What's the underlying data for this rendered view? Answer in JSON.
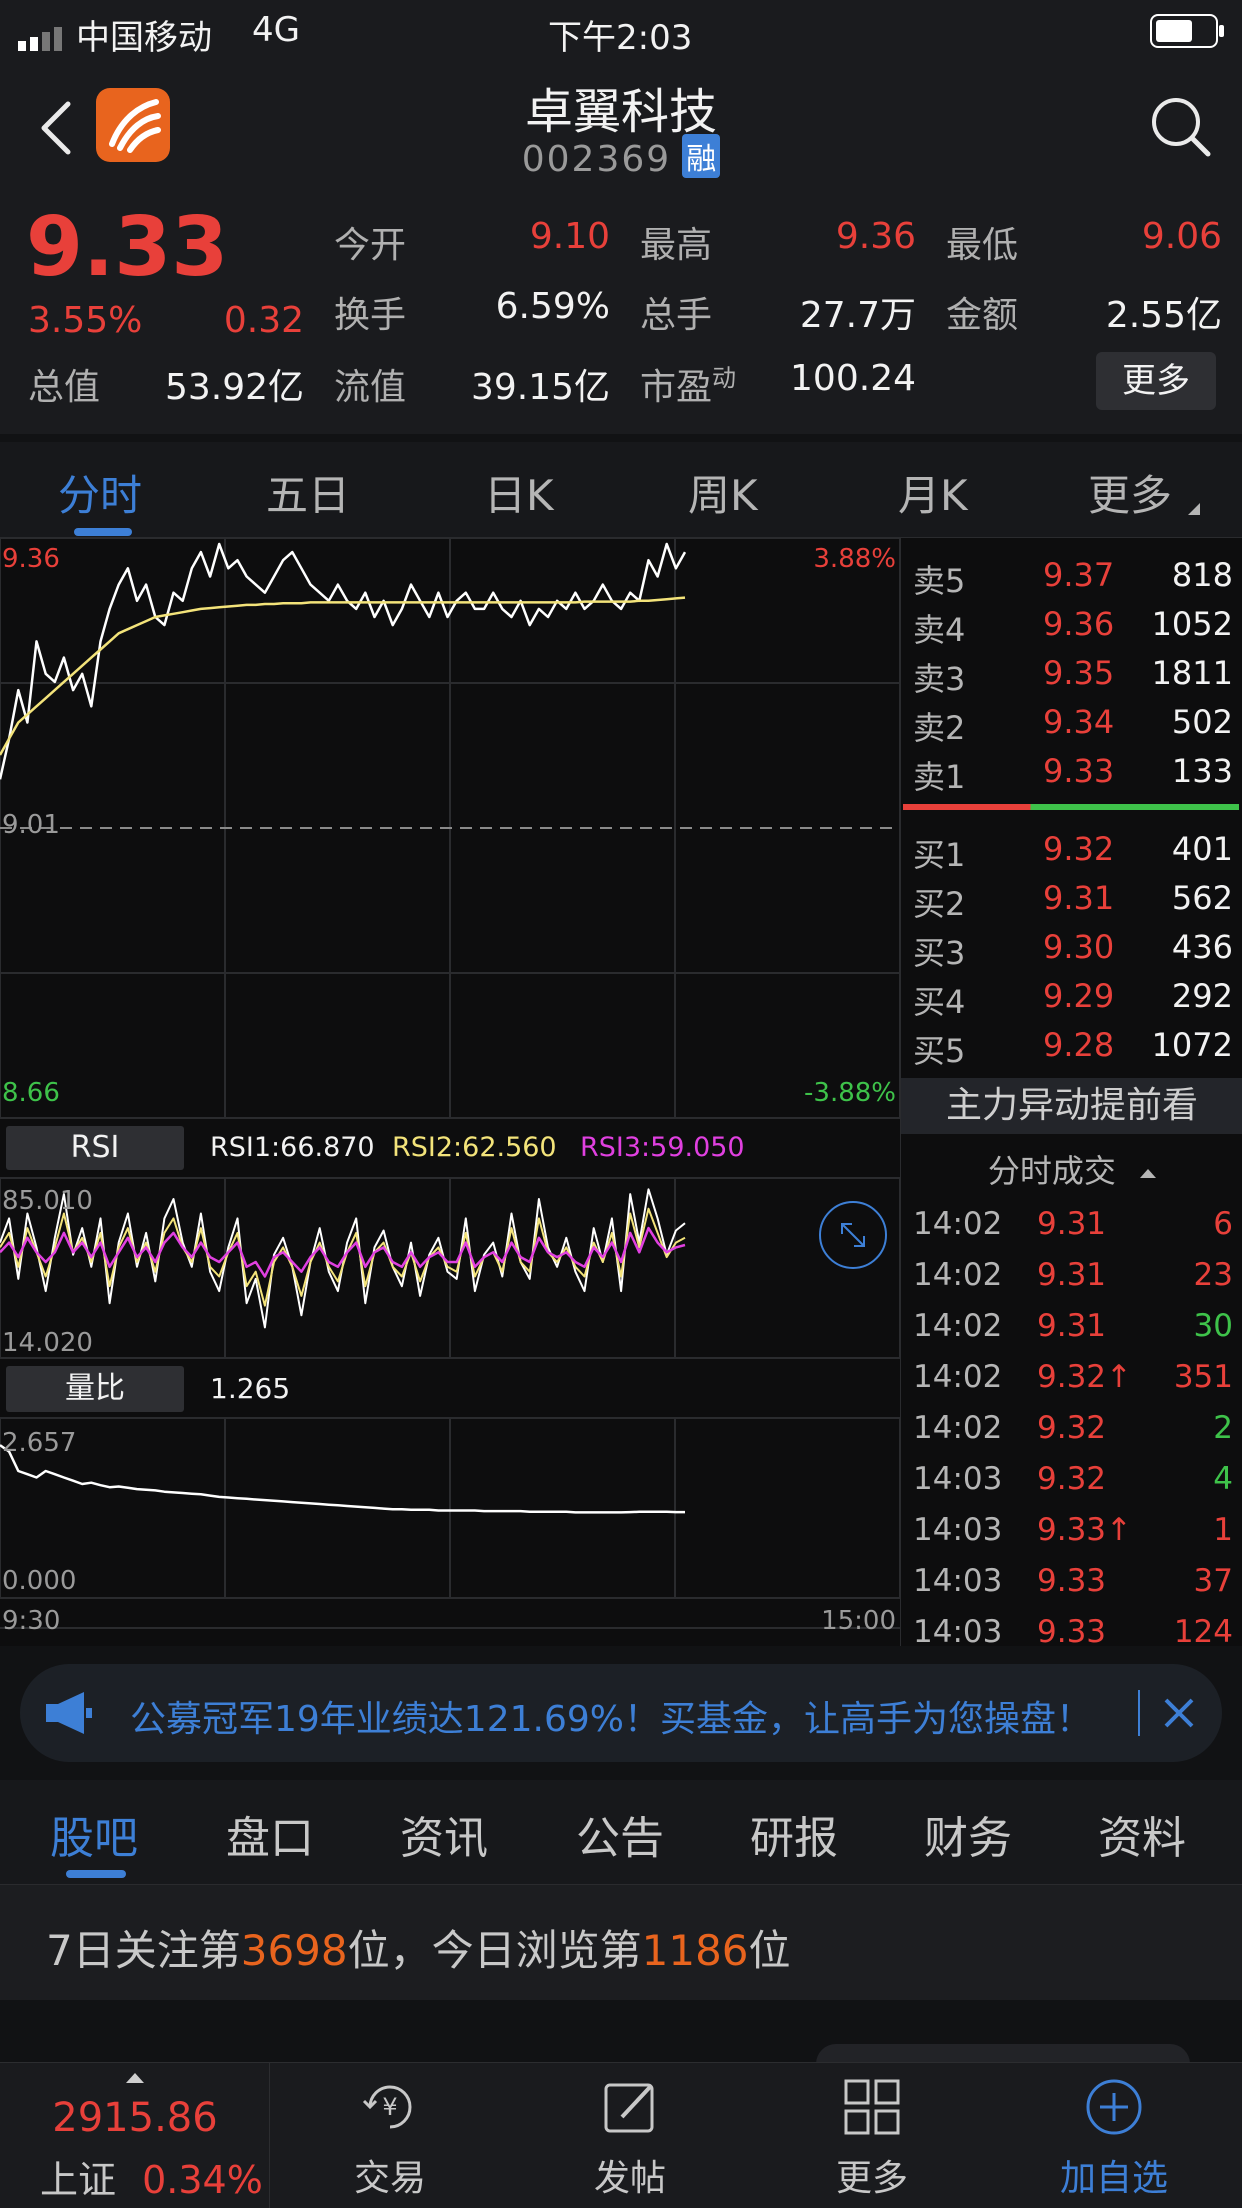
{
  "status_bar": {
    "carrier": "中国移动",
    "network": "4G",
    "time": "下午2:03"
  },
  "header": {
    "title": "卓翼科技",
    "code": "002369",
    "margin_badge": "融"
  },
  "quote": {
    "price": "9.33",
    "change_pct": "3.55%",
    "change": "0.32",
    "rows": [
      [
        {
          "label": "今开",
          "value": "9.10",
          "color": "#e8403a"
        },
        {
          "label": "最高",
          "value": "9.36",
          "color": "#e8403a"
        },
        {
          "label": "最低",
          "value": "9.06",
          "color": "#e8403a"
        }
      ],
      [
        {
          "label": "换手",
          "value": "6.59%",
          "color": "#f2f2f2"
        },
        {
          "label": "总手",
          "value": "27.7万",
          "color": "#f2f2f2"
        },
        {
          "label": "金额",
          "value": "2.55亿",
          "color": "#f2f2f2"
        }
      ]
    ],
    "total_value_label": "总值",
    "total_value": "53.92亿",
    "float_value_label": "流值",
    "float_value": "39.15亿",
    "pe_label": "市盈",
    "pe_sup": "动",
    "pe_value": "100.24",
    "more_button": "更多"
  },
  "period_tabs": [
    "分时",
    "五日",
    "日K",
    "周K",
    "月K",
    "更多"
  ],
  "intraday": {
    "y_top": "9.36",
    "y_mid": "9.01",
    "y_bottom": "8.66",
    "pct_top": "3.88%",
    "pct_bottom": "-3.88%",
    "price_values": [
      9.07,
      9.12,
      9.18,
      9.14,
      9.24,
      9.2,
      9.19,
      9.22,
      9.18,
      9.2,
      9.16,
      9.24,
      9.28,
      9.31,
      9.33,
      9.29,
      9.31,
      9.27,
      9.26,
      9.3,
      9.29,
      9.33,
      9.35,
      9.32,
      9.36,
      9.33,
      9.34,
      9.32,
      9.31,
      9.3,
      9.32,
      9.34,
      9.35,
      9.33,
      9.31,
      9.3,
      9.29,
      9.31,
      9.29,
      9.28,
      9.3,
      9.27,
      9.29,
      9.26,
      9.28,
      9.31,
      9.29,
      9.27,
      9.3,
      9.27,
      9.29,
      9.3,
      9.28,
      9.28,
      9.3,
      9.28,
      9.27,
      9.29,
      9.26,
      9.28,
      9.27,
      9.29,
      9.28,
      9.3,
      9.28,
      9.29,
      9.31,
      9.29,
      9.28,
      9.3,
      9.29,
      9.34,
      9.32,
      9.36,
      9.33,
      9.35
    ],
    "avg_values": [
      9.1,
      9.12,
      9.14,
      9.15,
      9.16,
      9.17,
      9.18,
      9.19,
      9.2,
      9.21,
      9.22,
      9.23,
      9.24,
      9.25,
      9.255,
      9.26,
      9.265,
      9.27,
      9.272,
      9.274,
      9.276,
      9.278,
      9.28,
      9.281,
      9.282,
      9.283,
      9.284,
      9.285,
      9.285,
      9.286,
      9.286,
      9.287,
      9.287,
      9.287,
      9.288,
      9.288,
      9.288,
      9.288,
      9.288,
      9.288,
      9.288,
      9.288,
      9.288,
      9.288,
      9.288,
      9.288,
      9.288,
      9.288,
      9.288,
      9.288,
      9.288,
      9.288,
      9.288,
      9.288,
      9.288,
      9.288,
      9.288,
      9.288,
      9.288,
      9.288,
      9.288,
      9.288,
      9.288,
      9.288,
      9.289,
      9.289,
      9.289,
      9.289,
      9.289,
      9.289,
      9.29,
      9.29,
      9.291,
      9.292,
      9.293,
      9.294
    ]
  },
  "rsi": {
    "title": "RSI",
    "rsi1": "RSI1:66.870",
    "rsi2": "RSI2:62.560",
    "rsi3": "RSI3:59.050",
    "y_top": "85.010",
    "y_bottom": "14.020",
    "rsi1_values": [
      60,
      70,
      45,
      72,
      58,
      40,
      62,
      80,
      55,
      66,
      50,
      70,
      35,
      60,
      72,
      50,
      64,
      44,
      70,
      78,
      60,
      50,
      72,
      48,
      40,
      58,
      70,
      35,
      45,
      25,
      55,
      62,
      50,
      30,
      52,
      66,
      48,
      40,
      60,
      70,
      35,
      58,
      65,
      50,
      42,
      60,
      38,
      55,
      62,
      48,
      45,
      70,
      40,
      55,
      60,
      46,
      72,
      52,
      45,
      78,
      58,
      50,
      62,
      48,
      40,
      66,
      52,
      70,
      40,
      80,
      60,
      82,
      70,
      55,
      65,
      68
    ],
    "rsi2_values": [
      58,
      64,
      50,
      66,
      56,
      46,
      58,
      72,
      56,
      62,
      52,
      64,
      42,
      58,
      66,
      52,
      60,
      48,
      64,
      70,
      58,
      52,
      66,
      50,
      46,
      56,
      64,
      42,
      48,
      34,
      52,
      58,
      50,
      38,
      52,
      60,
      50,
      44,
      56,
      64,
      42,
      56,
      60,
      50,
      46,
      56,
      44,
      54,
      58,
      50,
      48,
      64,
      46,
      54,
      56,
      48,
      66,
      52,
      48,
      70,
      56,
      52,
      58,
      50,
      46,
      60,
      52,
      64,
      46,
      72,
      58,
      74,
      64,
      54,
      60,
      62
    ],
    "rsi3_values": [
      56,
      60,
      54,
      62,
      56,
      52,
      56,
      64,
      56,
      60,
      54,
      60,
      50,
      56,
      62,
      54,
      58,
      52,
      60,
      64,
      58,
      54,
      60,
      54,
      52,
      56,
      60,
      50,
      52,
      46,
      54,
      56,
      52,
      48,
      54,
      58,
      52,
      50,
      56,
      60,
      50,
      56,
      58,
      52,
      50,
      56,
      50,
      54,
      56,
      52,
      52,
      60,
      50,
      54,
      56,
      52,
      60,
      54,
      52,
      62,
      56,
      54,
      56,
      52,
      50,
      58,
      54,
      60,
      52,
      64,
      56,
      66,
      60,
      56,
      58,
      59
    ]
  },
  "volume_ratio": {
    "title": "量比",
    "value": "1.265",
    "y_top": "2.657",
    "y_bottom": "0.000",
    "x_start": "9:30",
    "x_end": "15:00",
    "values": [
      2.3,
      2.2,
      1.9,
      1.85,
      1.8,
      1.9,
      1.85,
      1.8,
      1.75,
      1.7,
      1.72,
      1.68,
      1.65,
      1.66,
      1.64,
      1.62,
      1.61,
      1.6,
      1.58,
      1.57,
      1.56,
      1.55,
      1.54,
      1.52,
      1.5,
      1.49,
      1.48,
      1.47,
      1.46,
      1.45,
      1.44,
      1.43,
      1.42,
      1.41,
      1.4,
      1.39,
      1.38,
      1.37,
      1.36,
      1.35,
      1.34,
      1.33,
      1.32,
      1.31,
      1.31,
      1.3,
      1.3,
      1.3,
      1.29,
      1.29,
      1.29,
      1.29,
      1.29,
      1.28,
      1.28,
      1.28,
      1.28,
      1.28,
      1.27,
      1.27,
      1.27,
      1.27,
      1.27,
      1.26,
      1.26,
      1.26,
      1.26,
      1.26,
      1.26,
      1.265,
      1.27,
      1.27,
      1.27,
      1.27,
      1.265,
      1.265
    ]
  },
  "order_book": {
    "asks": [
      {
        "label": "卖5",
        "price": "9.37",
        "vol": "818"
      },
      {
        "label": "卖4",
        "price": "9.36",
        "vol": "1052"
      },
      {
        "label": "卖3",
        "price": "9.35",
        "vol": "1811"
      },
      {
        "label": "卖2",
        "price": "9.34",
        "vol": "502"
      },
      {
        "label": "卖1",
        "price": "9.33",
        "vol": "133"
      }
    ],
    "bids": [
      {
        "label": "买1",
        "price": "9.32",
        "vol": "401"
      },
      {
        "label": "买2",
        "price": "9.31",
        "vol": "562"
      },
      {
        "label": "买3",
        "price": "9.30",
        "vol": "436"
      },
      {
        "label": "买4",
        "price": "9.29",
        "vol": "292"
      },
      {
        "label": "买5",
        "price": "9.28",
        "vol": "1072"
      }
    ],
    "promo": "主力异动提前看",
    "ticks_title": "分时成交",
    "ticks": [
      {
        "time": "14:02",
        "price": "9.31",
        "vol": "6",
        "color": "#e8403a"
      },
      {
        "time": "14:02",
        "price": "9.31",
        "vol": "23",
        "color": "#e8403a"
      },
      {
        "time": "14:02",
        "price": "9.31",
        "vol": "30",
        "color": "#3ec24a"
      },
      {
        "time": "14:02",
        "price": "9.32↑",
        "vol": "351",
        "color": "#e8403a"
      },
      {
        "time": "14:02",
        "price": "9.32",
        "vol": "2",
        "color": "#3ec24a"
      },
      {
        "time": "14:03",
        "price": "9.32",
        "vol": "4",
        "color": "#3ec24a"
      },
      {
        "time": "14:03",
        "price": "9.33↑",
        "vol": "1",
        "color": "#e8403a"
      },
      {
        "time": "14:03",
        "price": "9.33",
        "vol": "37",
        "color": "#e8403a"
      },
      {
        "time": "14:03",
        "price": "9.33",
        "vol": "124",
        "color": "#e8403a"
      }
    ]
  },
  "banner": {
    "text": "公募冠军19年业绩达121.69%！买基金，让高手为您操盘！"
  },
  "sub_tabs": [
    "股吧",
    "盘口",
    "资讯",
    "公告",
    "研报",
    "财务",
    "资料"
  ],
  "rank": {
    "prefix": "7日关注第",
    "attention_rank": "3698",
    "middle": "位，今日浏览第",
    "view_rank": "1186",
    "suffix": "位"
  },
  "bottom_nav": {
    "index_value": "2915.86",
    "index_name": "上证",
    "index_change": "0.34%",
    "items": [
      "交易",
      "发帖",
      "更多",
      "加自选"
    ]
  },
  "colors": {
    "up": "#e8403a",
    "down": "#3ec24a",
    "accent": "#3d7fd6",
    "avg_line": "#f3e37a",
    "rsi3": "#e040e0"
  }
}
